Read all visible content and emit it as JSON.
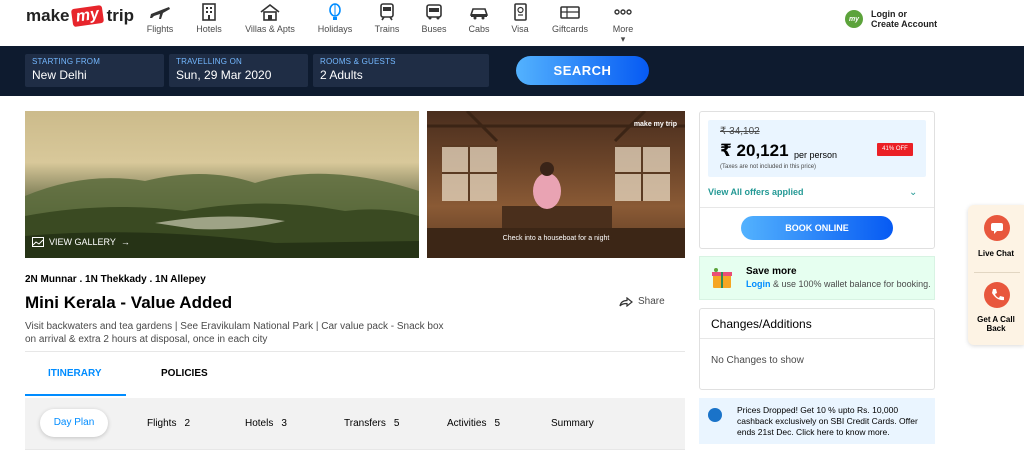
{
  "nav": {
    "logo": {
      "pre": "make",
      "mid": "my",
      "post": "trip"
    },
    "items": [
      {
        "label": "Flights",
        "icon": "plane-icon"
      },
      {
        "label": "Hotels",
        "icon": "hotel-icon"
      },
      {
        "label": "Villas & Apts",
        "icon": "villa-icon"
      },
      {
        "label": "Holidays",
        "icon": "balloon-icon"
      },
      {
        "label": "Trains",
        "icon": "train-icon"
      },
      {
        "label": "Buses",
        "icon": "bus-icon"
      },
      {
        "label": "Cabs",
        "icon": "cab-icon"
      },
      {
        "label": "Visa",
        "icon": "passport-icon"
      },
      {
        "label": "Giftcards",
        "icon": "giftcard-icon"
      },
      {
        "label": "More",
        "icon": "more-icon"
      }
    ],
    "login": {
      "badge": "my",
      "line1": "Login or",
      "line2": "Create Account"
    }
  },
  "search": {
    "fields": [
      {
        "label": "STARTING FROM",
        "value": "New Delhi"
      },
      {
        "label": "TRAVELLING ON",
        "value": "Sun, 29 Mar 2020"
      },
      {
        "label": "ROOMS & GUESTS",
        "value": "2 Adults"
      }
    ],
    "button": "SEARCH"
  },
  "gallery": {
    "view_label": "VIEW GALLERY",
    "side_caption": "Check into a houseboat for a night",
    "watermark": "make my trip"
  },
  "package": {
    "duration": "2N Munnar . 1N Thekkady . 1N Allepey",
    "title": "Mini Kerala - Value Added",
    "share": "Share",
    "description": "Visit backwaters and tea gardens | See Eravikulam National Park | Car value pack - Snack box on arrival & extra 2 hours at disposal, once in each city"
  },
  "tabs": [
    {
      "label": "ITINERARY"
    },
    {
      "label": "POLICIES"
    }
  ],
  "dayplan": {
    "active": "Day Plan",
    "items": [
      {
        "label": "Flights",
        "count": "2"
      },
      {
        "label": "Hotels",
        "count": "3"
      },
      {
        "label": "Transfers",
        "count": "5"
      },
      {
        "label": "Activities",
        "count": "5"
      },
      {
        "label": "Summary",
        "count": ""
      }
    ]
  },
  "price": {
    "original": "₹ 34,102",
    "current": "₹ 20,121",
    "per": "per person",
    "taxes": "(Taxes are not included in this price)",
    "off": "41% OFF",
    "offers": "View All offers applied",
    "book": "BOOK ONLINE"
  },
  "savemore": {
    "title": "Save more",
    "link": "Login",
    "rest": " & use 100% wallet balance for booking."
  },
  "changes": {
    "title": "Changes/Additions",
    "empty": "No Changes to show"
  },
  "drop": {
    "text": "Prices Dropped! Get 10 % upto Rs. 10,000 cashback exclusively on SBI Credit Cards. Offer ends 21st Dec. Click here to know more."
  },
  "floating": {
    "chat": "Live Chat",
    "callback": "Get A Call Back"
  },
  "colors": {
    "brand_red": "#e7252c",
    "accent_blue": "#008cff",
    "header_dark": "#0e1b2f",
    "offer_teal": "#249995"
  }
}
